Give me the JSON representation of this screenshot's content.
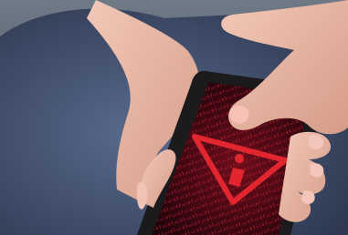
{
  "photo": {
    "subject": "hands-holding-phone",
    "screen_theme": "red-binary-code",
    "icon": "warning-triangle-icon",
    "colors": {
      "background": "#3c4658",
      "shirt": "#4d5b7a",
      "skin": "#e8b7a6",
      "phone_body": "#1b1a1d",
      "screen": "#2a0710",
      "alert_red": "#e2262f"
    }
  }
}
